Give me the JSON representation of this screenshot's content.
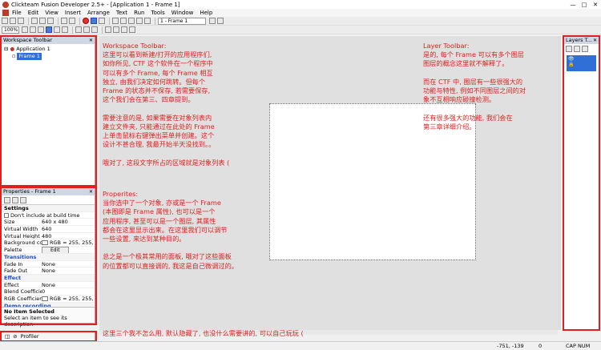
{
  "window": {
    "title": "Clickteam Fusion Developer 2.5+ - [Application 1 - Frame 1]",
    "min": "—",
    "max": "□",
    "close": "✕"
  },
  "menu": [
    "File",
    "Edit",
    "View",
    "Insert",
    "Arrange",
    "Text",
    "Run",
    "Tools",
    "Window",
    "Help"
  ],
  "toolbar": {
    "frame_select": "1 - Frame 1",
    "zoom": "100%"
  },
  "workspace": {
    "title": "Workspace Toolbar",
    "application": "Application 1",
    "frame": "Frame 1"
  },
  "properties": {
    "title": "Properties - Frame 1",
    "rows": [
      {
        "type": "hd",
        "k": "Settings",
        "v": ""
      },
      {
        "type": "cb",
        "k": "Don't include at build time",
        "v": ""
      },
      {
        "type": "kv",
        "k": "Size",
        "v": "640 x 480"
      },
      {
        "type": "kv",
        "k": "Virtual Width",
        "v": "640"
      },
      {
        "type": "kv",
        "k": "Virtual Height",
        "v": "480"
      },
      {
        "type": "sw",
        "k": "Background col",
        "v": "RGB = 255, 255, 2"
      },
      {
        "type": "btn",
        "k": "Palette",
        "v": "Edit"
      },
      {
        "type": "sec",
        "k": "Transitions",
        "v": ""
      },
      {
        "type": "kv",
        "k": "Fade In",
        "v": "None"
      },
      {
        "type": "kv",
        "k": "Fade Out",
        "v": "None"
      },
      {
        "type": "sec",
        "k": "Effect",
        "v": ""
      },
      {
        "type": "kv",
        "k": "Effect",
        "v": "None"
      },
      {
        "type": "kv",
        "k": "Blend Coefficie",
        "v": "0"
      },
      {
        "type": "sw",
        "k": "RGB Coefficient",
        "v": "RGB = 255, 255, 2"
      },
      {
        "type": "sec",
        "k": "Demo recording",
        "v": ""
      }
    ],
    "footer_title": "No Item Selected",
    "footer_desc": "Select an item to see its description"
  },
  "bottom_tab": "Profiler",
  "layers": {
    "title": "Layers T..."
  },
  "notes": {
    "workspace": "Workspace Toolbar:\n这里可以看到新建/打开的应用程序们,\n如你所见, CTF 这个软件在一个程序中\n可以有多个 Frame, 每个 Frame 相互\n独立, 由我们决定如何跳转。但每个\nFrame 的状态并不保存, 若需要保存,\n这个我们会在第三、四章提到。\n\n需要注意的是, 如果需要在对象列表内\n建立文件夹, 只能通过在此处的 Frame\n上单击鼠标右键弹出菜单并创建。这个\n设计不甚合理, 我最开始半天没找到。。\n\n哦对了, 这段文字所占的区域就是对象列表 (",
    "properties": "Properites:\n当你选中了一个对象, 亦或是一个 Frame\n(本图即是 Frame 属性), 也可以是一个\n应用程序, 甚至可以是一个图层, 其属性\n都会在这里显示出来。在这里我们可以调节\n一些设置, 来达到某种目的。\n\n总之是一个极其常用的面板, 哦对了这些面板\n的位置都可以直接调的, 我这是自己微调过的。",
    "layer": "Layer Toolbar:\n是的, 每个 Frame 可以有多个图层\n图层的概念这里就不解释了。\n\n而在 CTF 中, 图层有一些很强大的\n功能与特性, 例如不同图层之间的对\n象不互相响应碰撞检测。\n\n还有很多强大的功能, 我们会在\n第三章详细介绍。",
    "bottom": "这里三个我不怎么用, 默认隐藏了, 也没什么需要讲的, 可以自己玩玩 ("
  },
  "status": {
    "coords": "-751, -139",
    "zoom": "0",
    "caps": "CAP NUM"
  },
  "colors": {
    "annotation": "#e02020",
    "selection": "#2f6fd6"
  }
}
